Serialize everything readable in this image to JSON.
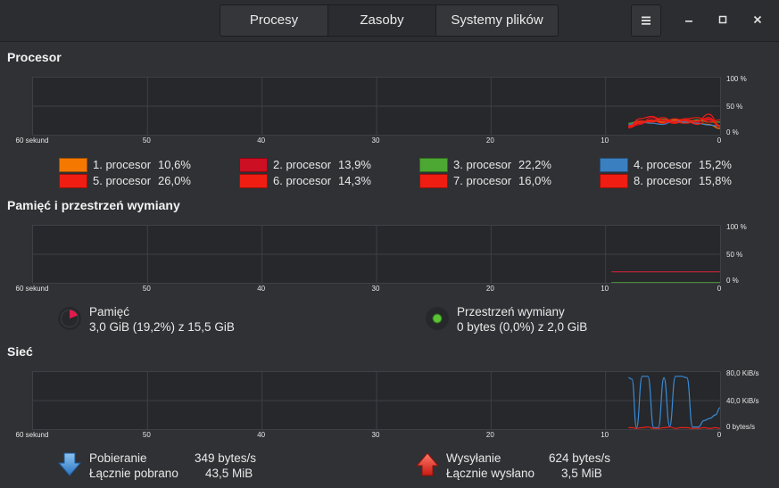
{
  "header": {
    "tabs": [
      {
        "label": "Procesy",
        "active": false
      },
      {
        "label": "Zasoby",
        "active": true
      },
      {
        "label": "Systemy plików",
        "active": false
      }
    ],
    "menu_icon": "hamburger-icon",
    "window_buttons": [
      "minimize-icon",
      "maximize-icon",
      "close-icon"
    ]
  },
  "cpu": {
    "title": "Procesor",
    "x_labels": [
      "60 sekund",
      "50",
      "40",
      "30",
      "20",
      "10",
      "0"
    ],
    "y_labels": [
      "100 %",
      "50 %",
      "0 %"
    ],
    "legend": [
      {
        "label": "1. procesor",
        "value": "10,6%",
        "color": "#f57900"
      },
      {
        "label": "2. procesor",
        "value": "13,9%",
        "color": "#cc0f23"
      },
      {
        "label": "3. procesor",
        "value": "22,2%",
        "color": "#4ca832"
      },
      {
        "label": "4. procesor",
        "value": "15,2%",
        "color": "#3a7fc0"
      },
      {
        "label": "5. procesor",
        "value": "26,0%",
        "color": "#ef1d12"
      },
      {
        "label": "6. procesor",
        "value": "14,3%",
        "color": "#ef1d12"
      },
      {
        "label": "7. procesor",
        "value": "16,0%",
        "color": "#ef1d12"
      },
      {
        "label": "8. procesor",
        "value": "15,8%",
        "color": "#ef1d12"
      }
    ]
  },
  "memory": {
    "title": "Pamięć i przestrzeń wymiany",
    "x_labels": [
      "60 sekund",
      "50",
      "40",
      "30",
      "20",
      "10",
      "0"
    ],
    "y_labels": [
      "100 %",
      "50 %",
      "0 %"
    ],
    "ram": {
      "label": "Pamięć",
      "value": "3,0 GiB (19,2%) z 15,5 GiB",
      "color": "#e01b4c",
      "icon": "memory-pie-icon",
      "fraction": 0.192
    },
    "swap": {
      "label": "Przestrzeń wymiany",
      "value": "0 bytes (0,0%) z 2,0 GiB",
      "color": "#5bc236",
      "icon": "swap-pie-icon",
      "fraction": 0.0
    }
  },
  "network": {
    "title": "Sieć",
    "x_labels": [
      "60 sekund",
      "50",
      "40",
      "30",
      "20",
      "10",
      "0"
    ],
    "y_labels": [
      "80,0 KiB/s",
      "40,0 KiB/s",
      "0 bytes/s"
    ],
    "download": {
      "label": "Pobieranie",
      "rate": "349 bytes/s",
      "total_label": "Łącznie pobrano",
      "total": "43,5 MiB",
      "icon": "download-arrow-icon",
      "color": "#3a8ad6"
    },
    "upload": {
      "label": "Wysyłanie",
      "rate": "624 bytes/s",
      "total_label": "Łącznie wysłano",
      "total": "3,5 MiB",
      "icon": "upload-arrow-icon",
      "color": "#e8221a"
    }
  },
  "chart_data": [
    {
      "type": "line",
      "x": [
        8,
        7,
        6,
        5,
        4,
        3,
        2,
        1,
        0
      ],
      "xlim": [
        60,
        0
      ],
      "ylim": [
        0,
        100
      ],
      "series": [
        {
          "name": "1. procesor",
          "values": [
            15,
            20,
            25,
            22,
            26,
            24,
            20,
            18,
            11
          ],
          "color": "#f57900"
        },
        {
          "name": "2. procesor",
          "values": [
            12,
            18,
            30,
            24,
            20,
            25,
            22,
            28,
            14
          ],
          "color": "#cc0f23"
        },
        {
          "name": "3. procesor",
          "values": [
            20,
            24,
            22,
            27,
            25,
            21,
            26,
            22,
            22
          ],
          "color": "#4ca832"
        },
        {
          "name": "4. procesor",
          "values": [
            18,
            22,
            20,
            18,
            24,
            22,
            20,
            17,
            15
          ],
          "color": "#3a7fc0"
        },
        {
          "name": "5. procesor",
          "values": [
            14,
            28,
            32,
            26,
            24,
            28,
            30,
            22,
            26
          ],
          "color": "#ef1d12"
        },
        {
          "name": "6. procesor",
          "values": [
            16,
            20,
            24,
            30,
            22,
            20,
            24,
            30,
            14
          ],
          "color": "#ef1d12"
        },
        {
          "name": "7. procesor",
          "values": [
            12,
            22,
            26,
            20,
            28,
            24,
            18,
            26,
            16
          ],
          "color": "#ef1d12"
        },
        {
          "name": "8. procesor",
          "values": [
            14,
            24,
            22,
            26,
            20,
            26,
            24,
            36,
            16
          ],
          "color": "#ef1d12"
        }
      ]
    },
    {
      "type": "line",
      "x": [
        9.5,
        0
      ],
      "xlim": [
        60,
        0
      ],
      "ylim": [
        0,
        100
      ],
      "series": [
        {
          "name": "Pamięć",
          "values": [
            19.2,
            19.2
          ],
          "color": "#cc1f3a"
        },
        {
          "name": "Przestrzeń wymiany",
          "values": [
            0,
            0
          ],
          "color": "#5bc236"
        }
      ]
    },
    {
      "type": "line",
      "x": [
        8,
        7.7,
        7.3,
        6.8,
        6.3,
        5.8,
        5.4,
        4.9,
        4.4,
        3.9,
        3.4,
        2.9,
        2.4,
        1.9,
        1.4,
        0.9,
        0.4,
        0
      ],
      "xlim": [
        60,
        0
      ],
      "ylim": [
        0,
        80
      ],
      "series": [
        {
          "name": "Pobieranie",
          "values": [
            72,
            70,
            2,
            74,
            74,
            2,
            2,
            72,
            4,
            74,
            74,
            72,
            3,
            3,
            12,
            15,
            20,
            30
          ],
          "color": "#3a8ad6"
        },
        {
          "name": "Wysyłanie",
          "values": [
            2,
            2,
            1,
            2,
            3,
            1,
            1,
            2,
            3,
            1,
            2,
            2,
            1,
            1,
            2,
            1,
            2,
            1
          ],
          "color": "#e8221a"
        }
      ]
    }
  ]
}
